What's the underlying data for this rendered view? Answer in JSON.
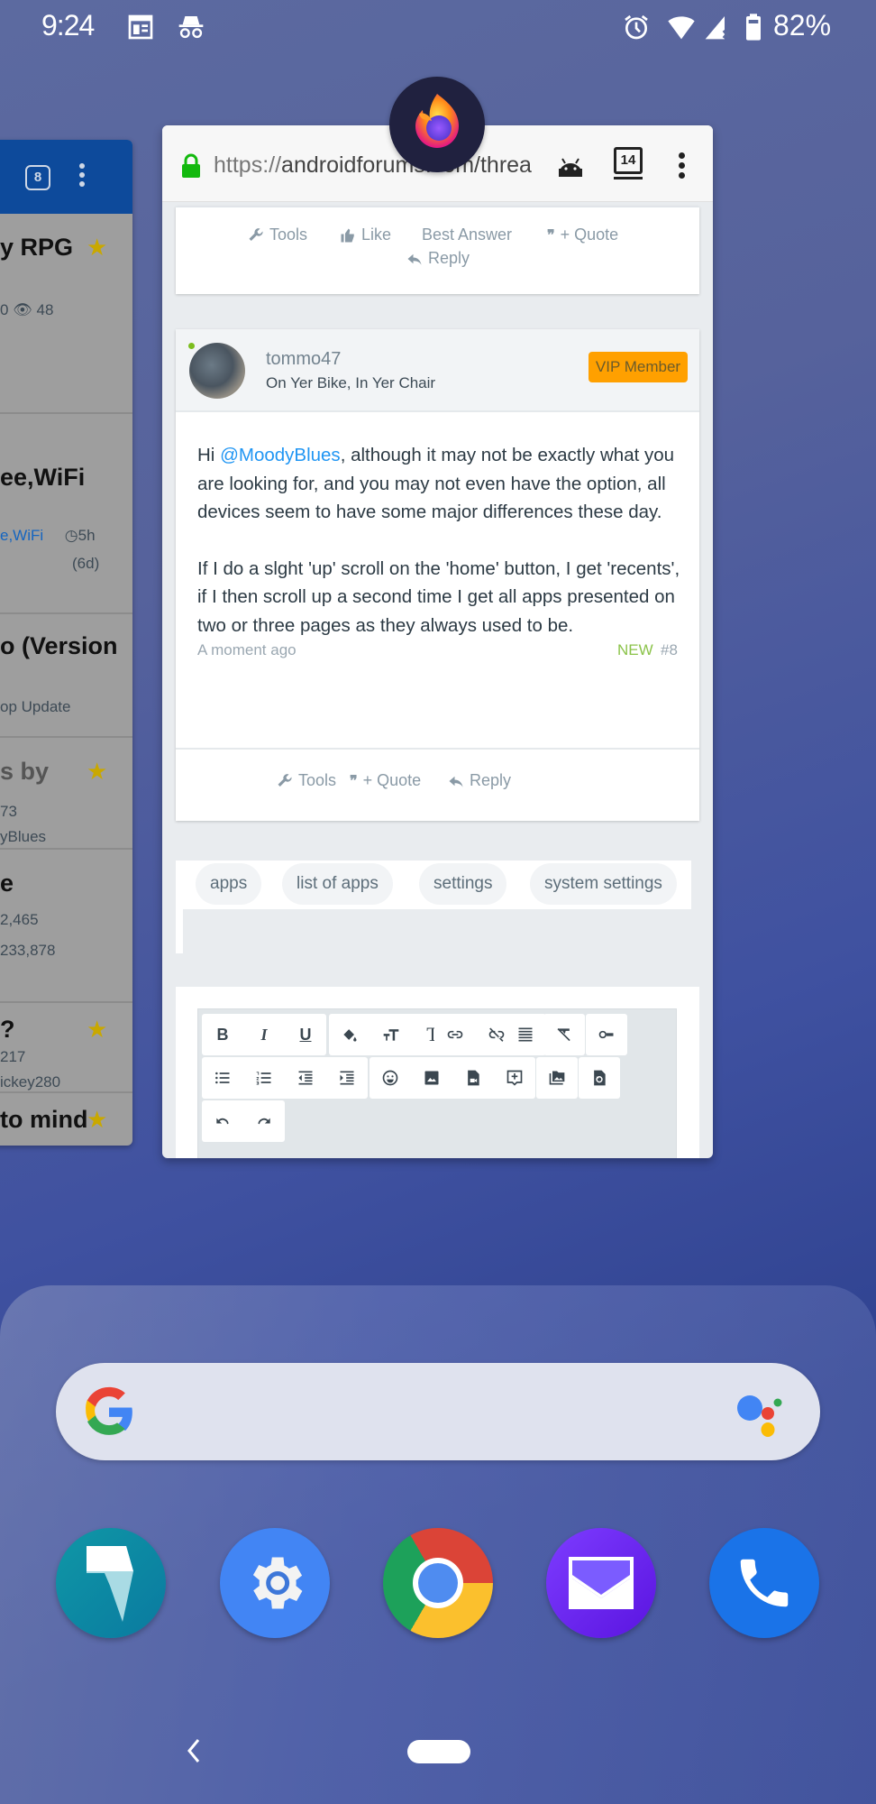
{
  "status_bar": {
    "time": "9:24",
    "left_icons": [
      "news-icon",
      "incognito-icon"
    ],
    "right_icons": [
      "alarm-icon",
      "wifi-icon",
      "no-signal-icon",
      "battery-icon"
    ],
    "battery": "82%"
  },
  "left_card": {
    "tab_count": "8",
    "rows": [
      {
        "title": "y RPG",
        "meta": "0  👁 48",
        "starred": true
      },
      {
        "title": "ee,WiFi",
        "meta_link": "e,WiFi",
        "meta_time": "5h",
        "meta_sub": "(6d)",
        "starred": false
      },
      {
        "title": "o (Version",
        "meta": "op Update",
        "starred": false
      },
      {
        "title": "s by",
        "meta": "73",
        "meta2": "yBlues",
        "starred": true
      },
      {
        "title": "e",
        "meta": "2,465",
        "meta2": "233,878",
        "starred": false
      },
      {
        "title": "?",
        "meta": "217",
        "meta2": "ickey280",
        "starred": true
      },
      {
        "title": "to mind",
        "starred": true
      }
    ]
  },
  "browser": {
    "app_icon": "firefox-icon",
    "url_protocol": "https://",
    "url_rest": "androidforums.com/threa",
    "tab_count": "14",
    "prev_post_actions": {
      "tools": "Tools",
      "like": "Like",
      "best_answer": "Best Answer",
      "quote": "+ Quote",
      "reply": "Reply"
    },
    "post": {
      "username": "tommo47",
      "user_title": "On Yer Bike, In Yer Chair",
      "badge": "VIP Member",
      "greeting": "Hi ",
      "mention": "@MoodyBlues",
      "para1_rest": ", although it may not be exactly what you are looking for, and you may not even have the option, all devices seem to have some major differences these day.",
      "para2": "If I do a slght 'up' scroll on the 'home' button, I get 'recents', if I then scroll up a second time I get all apps presented on two or three pages as they always used to be.",
      "time": "A moment ago",
      "new_label": "NEW",
      "post_number": "#8",
      "actions": {
        "tools": "Tools",
        "quote": "+ Quote",
        "reply": "Reply"
      }
    },
    "tags": [
      "apps",
      "list of apps",
      "settings",
      "system settings"
    ],
    "editor_toolbar": {
      "row1": [
        [
          "B",
          "I",
          "U"
        ],
        [
          "paint-bucket-icon",
          "text-size-icon",
          "font-icon"
        ],
        [
          "link-icon",
          "unlink-icon"
        ],
        [
          "align-icon"
        ],
        [
          "clear-format-icon"
        ],
        [
          "toggle-icon"
        ]
      ],
      "row2": [
        [
          "bullet-list-icon",
          "numbered-list-icon",
          "outdent-icon",
          "indent-icon"
        ],
        [
          "emoji-icon",
          "image-icon",
          "media-icon",
          "insert-icon"
        ],
        [
          "gallery-icon"
        ],
        [
          "restore-draft-icon"
        ]
      ],
      "row3": [
        [
          "undo-icon",
          "redo-icon"
        ]
      ]
    }
  },
  "home": {
    "search_icon": "google-g-icon",
    "assistant_icon": "google-assistant-icon",
    "dock": [
      "app-7-icon",
      "settings-icon",
      "chrome-icon",
      "email-icon",
      "phone-icon"
    ]
  },
  "nav": {
    "back": "back-icon",
    "home": "home-pill"
  }
}
